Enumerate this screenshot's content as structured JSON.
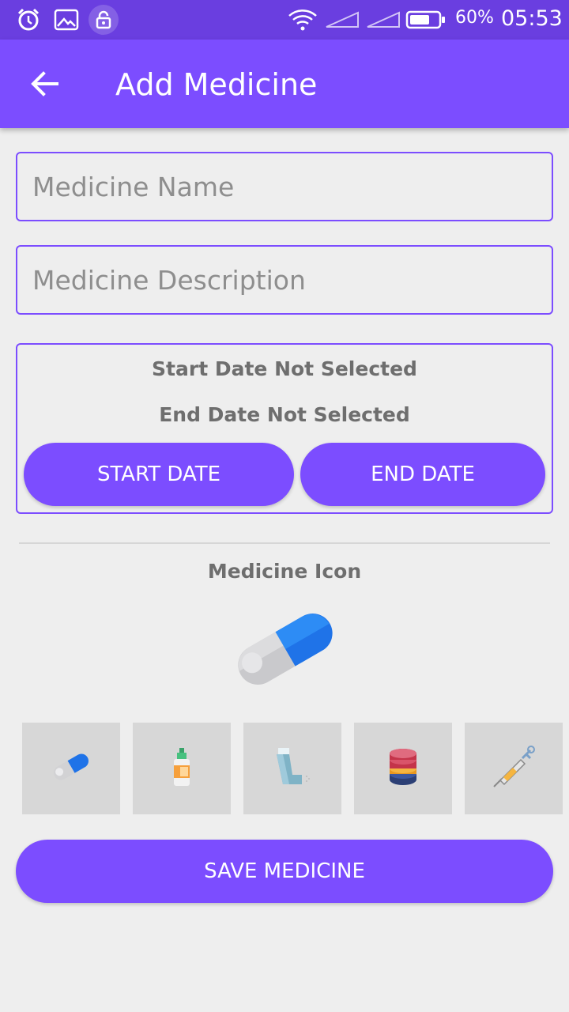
{
  "status_bar": {
    "battery_percent": "60%",
    "time": "05:53",
    "icons": [
      "alarm-icon",
      "image-icon",
      "lock-icon",
      "wifi-icon",
      "signal-icon",
      "signal-icon",
      "battery-icon"
    ]
  },
  "app_bar": {
    "title": "Add Medicine",
    "back_icon": "arrow-left-icon"
  },
  "form": {
    "name_placeholder": "Medicine Name",
    "name_value": "",
    "description_placeholder": "Medicine Description",
    "description_value": ""
  },
  "dates": {
    "start_status": "Start Date Not Selected",
    "end_status": "End Date Not Selected",
    "start_button": "START DATE",
    "end_button": "END DATE"
  },
  "icon_section": {
    "heading": "Medicine Icon",
    "selected_icon": "capsule-icon",
    "options": [
      "capsule-icon",
      "dropper-bottle-icon",
      "inhaler-icon",
      "tablets-stack-icon",
      "syringe-icon"
    ]
  },
  "save_button": "SAVE MEDICINE",
  "colors": {
    "primary": "#7c4dff",
    "status_bar": "#6a3ee0",
    "background": "#eeeeee",
    "tile": "#d7d7d7"
  }
}
